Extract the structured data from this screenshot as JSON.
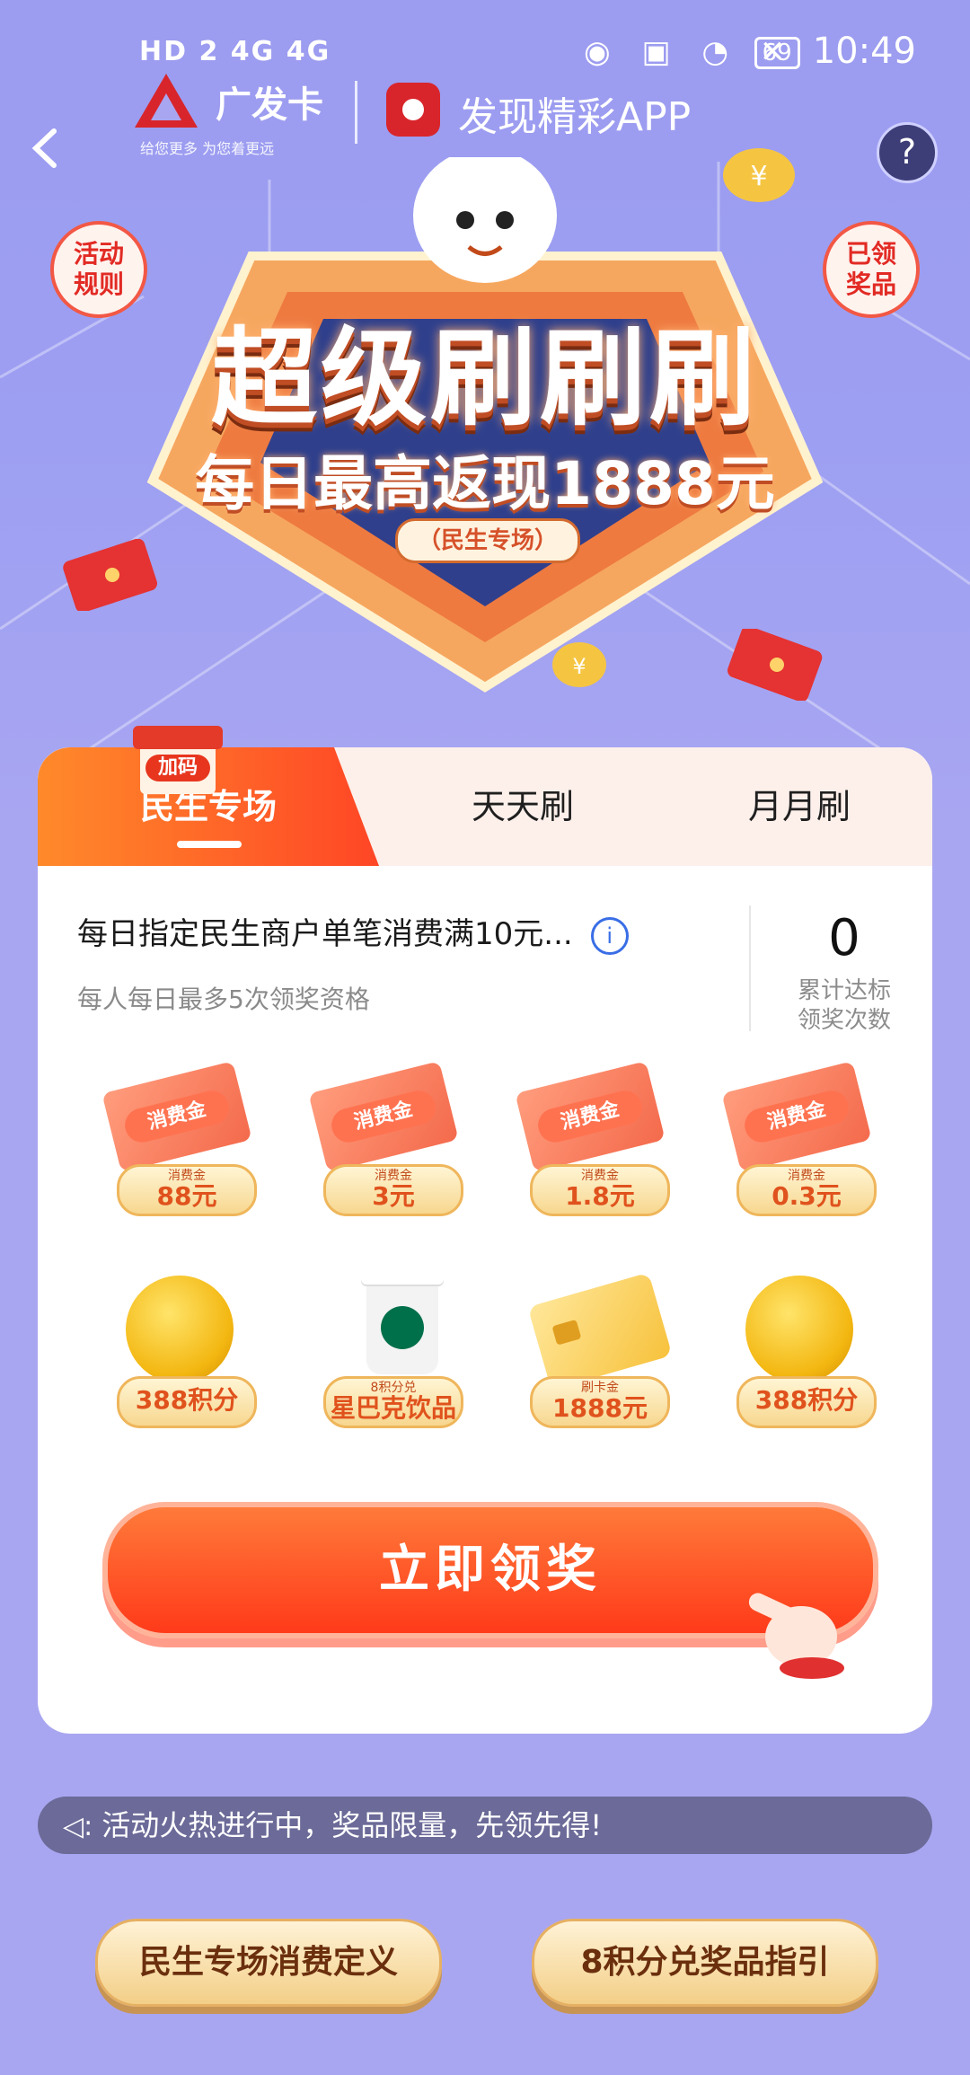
{
  "status_bar": {
    "left_text": "HD 2 4G 4G",
    "battery": "69",
    "time": "10:49"
  },
  "brand": {
    "bank_name": "广发卡",
    "slogan": "给您更多  为您着更远",
    "app_name": "发现精彩APP"
  },
  "nav": {
    "back_icon": "chevron-left-icon",
    "help_label": "?",
    "rules_label": "活动\n规则",
    "prizes_label": "已领\n奖品"
  },
  "banner": {
    "title": "超级刷刷刷",
    "subtitle": "每日最高返现1888元",
    "tag": "（民生专场）"
  },
  "tabs": [
    {
      "label": "民生专场",
      "active": true
    },
    {
      "label": "天天刷",
      "active": false
    },
    {
      "label": "月月刷",
      "active": false
    }
  ],
  "badge": {
    "label": "加码"
  },
  "task": {
    "title": "每日指定民生商户单笔消费满10元...",
    "subtitle": "每人每日最多5次领奖资格",
    "count": "0",
    "count_label": "累计达标\n领奖次数"
  },
  "prizes_row1": [
    {
      "ticket": "消费金",
      "caption": "消费金",
      "value": "88元"
    },
    {
      "ticket": "消费金",
      "caption": "消费金",
      "value": "3元"
    },
    {
      "ticket": "消费金",
      "caption": "消费金",
      "value": "1.8元"
    },
    {
      "ticket": "消费金",
      "caption": "消费金",
      "value": "0.3元"
    }
  ],
  "prizes_row2": [
    {
      "caption": "",
      "value": "388积分"
    },
    {
      "caption": "8积分兑",
      "value": "星巴克饮品"
    },
    {
      "caption": "刷卡金",
      "value": "1888元"
    },
    {
      "caption": "",
      "value": "388积分"
    }
  ],
  "cta": {
    "label": "立即领奖"
  },
  "notice": {
    "text": "活动火热进行中，奖品限量，先领先得!"
  },
  "bottom_buttons": {
    "left": "民生专场消费定义",
    "right": "8积分兑奖品指引"
  },
  "colors": {
    "background": "#a9a6f1",
    "accent": "#ff4626",
    "notice_bg": "#6b6a98"
  }
}
